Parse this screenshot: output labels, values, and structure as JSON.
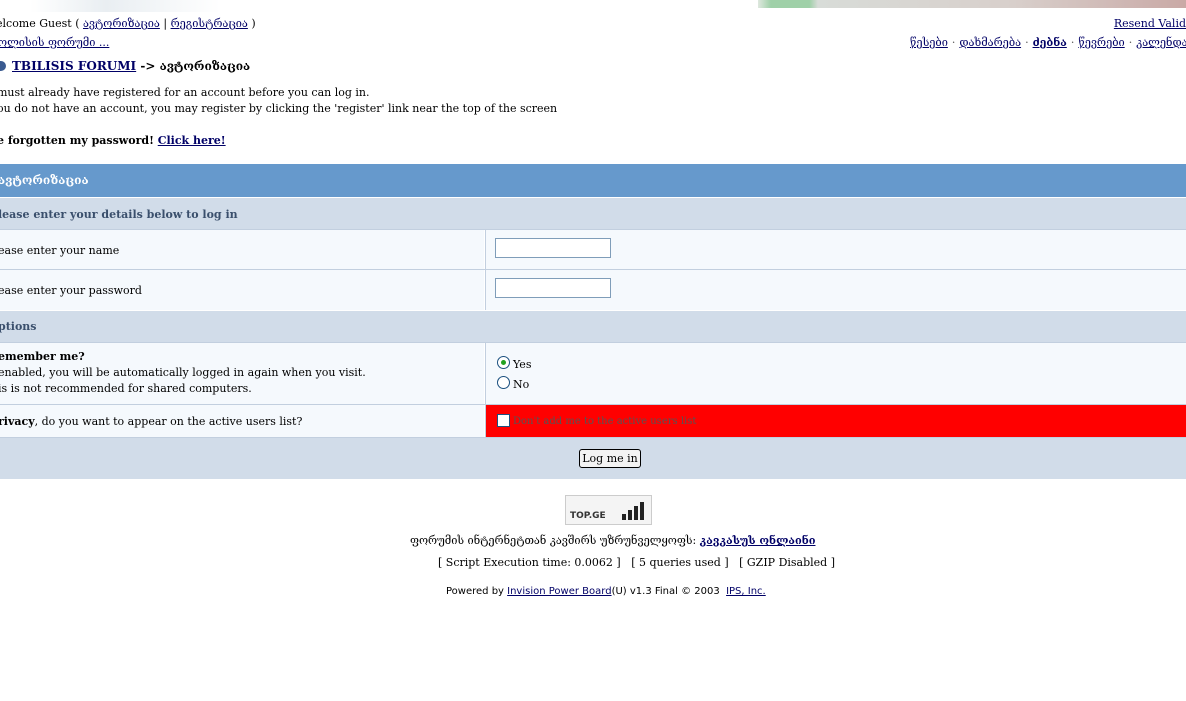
{
  "header": {
    "welcome_prefix": "elcome Guest ( ",
    "login_link": "ავტორიზაცია",
    "separator": " | ",
    "register_link": "რეგისტრაცია",
    "welcome_suffix": " )",
    "resend_validation": "Resend Valid",
    "breadcrumb_top": "ოლისის ფორუმი ...",
    "nav": [
      "წესები",
      "დახმარება",
      "ძებნა",
      "წევრები",
      "კალენდარ"
    ]
  },
  "navstrip": {
    "forum_link": "TBILISIS FORUMI",
    "arrow": " -> ",
    "current": "ავტორიზაცია"
  },
  "info": {
    "line1": "must already have registered for an account before you can log in.",
    "line2": "ou do not have an account, you may register by clicking the 'register' link near the top of the screen",
    "forgot_text": "e forgotten my password! ",
    "forgot_link": "Click here!"
  },
  "form": {
    "title": "ავტორიზაცია",
    "details_heading": "lease enter your details below to log in",
    "name_label": "ease enter your name",
    "password_label": "ease enter your password",
    "name_value": "",
    "password_value": "",
    "options_heading": "ptions",
    "remember_title": "emember me?",
    "remember_desc1": "enabled, you will be automatically logged in again when you visit.",
    "remember_desc2": "is is not recommended for shared computers.",
    "remember_yes": "Yes",
    "remember_no": "No",
    "remember_selected": "Yes",
    "privacy_title": "rivacy",
    "privacy_desc": ", do you want to appear on the active users list?",
    "privacy_checkbox_label": "Don't add me to the active users list",
    "privacy_checked": false,
    "submit_label": "Log me in"
  },
  "footer": {
    "badge_text": "TOP.GE",
    "credit_text": "ფორუმის ინტერნეტთან კავშირს უზრუნველყოფს: ",
    "credit_link": "კავკასუს ონლაინი",
    "stats": "[ Script Execution time: 0.0062 ]   [ 5 queries used ]   [ GZIP Disabled ]",
    "powered_prefix": "Powered by ",
    "powered_link": "Invision Power Board",
    "powered_version": "(U) v1.3 Final © 2003  ",
    "company_link": "IPS, Inc."
  },
  "colors": {
    "title_bar": "#6699cc",
    "subhead": "#d1dce9",
    "row_bg": "#f5f9fd",
    "privacy_highlight": "#ff0000",
    "link": "#000066"
  }
}
